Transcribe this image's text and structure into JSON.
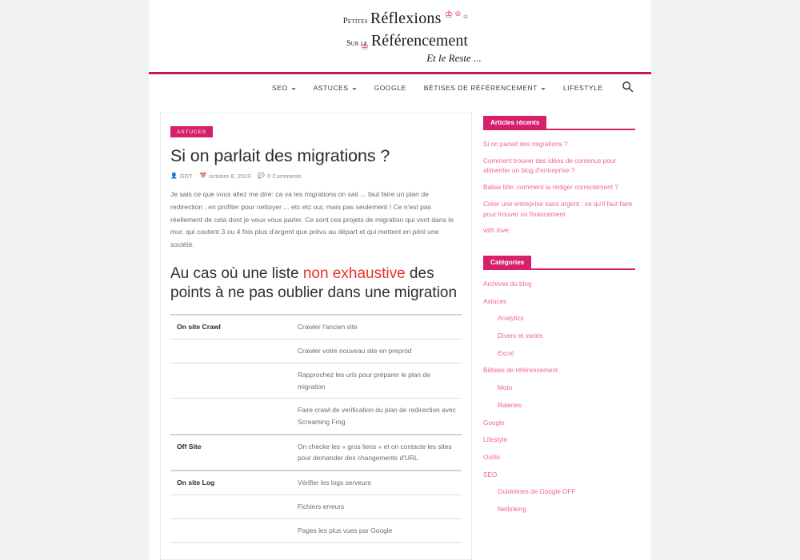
{
  "site": {
    "logo": {
      "line1_small": "Petites",
      "line1_big": "Réflexions",
      "line2_small": "Sur le",
      "line2_big": "Référencement",
      "line3": "Et le Reste ...",
      "butterfly_icon": "butterfly-icon"
    },
    "accent_color": "#d6206b",
    "rule_color": "#c2185b",
    "highlight_color": "#e8322a"
  },
  "nav": {
    "items": [
      {
        "label": "SEO",
        "has_dropdown": true
      },
      {
        "label": "ASTUCES",
        "has_dropdown": true
      },
      {
        "label": "GOOGLE",
        "has_dropdown": false
      },
      {
        "label": "BÉTISES DE RÉFÉRENCEMENT",
        "has_dropdown": true
      },
      {
        "label": "LIFESTYLE",
        "has_dropdown": false
      }
    ],
    "search_icon": "search-icon"
  },
  "post": {
    "category": "ASTUCES",
    "title": "Si on parlait des migrations ?",
    "meta": {
      "author_icon": "user-icon",
      "author": "GDT",
      "date_icon": "calendar-icon",
      "date": "octobre 8, 2023",
      "comments_icon": "comment-icon",
      "comments": "0 Comments"
    },
    "intro": "Je sais ce que vous allez me dire: ca va les migrations on sait ... faut faire un plan de redirection , en profiter pour nettoyer ... etc etc oui, mais pas seulement  ! Ce n'est pas réellement de cela dont je veux vous parler. Ce sont ces projets de migration qui vont dans le mur, qui coutent 3 ou 4 fois plus d'argent que prévu au départ et qui mettent en péril une société.",
    "heading": {
      "part1": "Au cas où une liste ",
      "highlight": "non exhaustive",
      "part2": " des points à ne pas oublier dans une migration"
    },
    "table": {
      "rows": [
        {
          "group": true,
          "label": "On site Crawl",
          "value": "Crawler l'ancien site"
        },
        {
          "group": false,
          "label": "",
          "value": "Crawler votre nouveau site en preprod"
        },
        {
          "group": false,
          "label": "",
          "value": "Rapprochez les urls pour préparer le plan de migration"
        },
        {
          "group": false,
          "label": "",
          "value": "Faire crawl de verification du  plan de redirection avec Screaming Frog"
        },
        {
          "group": true,
          "label": "Off Site",
          "value": "On checke les « gros liens » et on contacte les sites pour demander des changements d'URL"
        },
        {
          "group": true,
          "label": "On site Log",
          "value": "Vérifier les logs serveurs"
        },
        {
          "group": false,
          "label": "",
          "value": "Fichiers erreurs"
        },
        {
          "group": false,
          "label": "",
          "value": "Pages les plus vues par Google"
        }
      ]
    }
  },
  "sidebar": {
    "recent": {
      "title": "Articles récents",
      "items": [
        "Si on parlait des migrations ?",
        "Comment trouver des idées de contenus pour alimenter un blog d'entreprise ?",
        "Balise title: comment la rédiger correctement ?",
        "Créer une entreprise sans argent : ce qu'il faut faire pour trouver un financement",
        "with love"
      ]
    },
    "categories": {
      "title": "Catégories",
      "items": [
        {
          "label": "Archives du blog",
          "sub": false
        },
        {
          "label": "Astuces",
          "sub": false
        },
        {
          "label": "Analytics",
          "sub": true
        },
        {
          "label": "Divers et variés",
          "sub": true
        },
        {
          "label": "Excel",
          "sub": true
        },
        {
          "label": "Bêtises de référencement",
          "sub": false
        },
        {
          "label": "Moto",
          "sub": true
        },
        {
          "label": "Raleries",
          "sub": true
        },
        {
          "label": "Google",
          "sub": false
        },
        {
          "label": "Lifestyle",
          "sub": false
        },
        {
          "label": "Outils",
          "sub": false
        },
        {
          "label": "SEO",
          "sub": false
        },
        {
          "label": "Guidelines de Google OFF",
          "sub": true
        },
        {
          "label": "Netlinking",
          "sub": true
        }
      ]
    }
  }
}
